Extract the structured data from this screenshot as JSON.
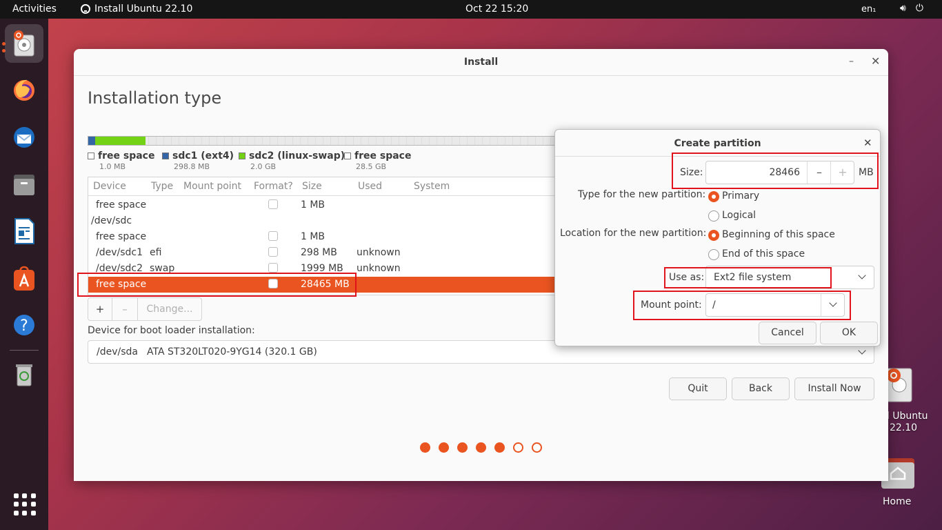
{
  "topbar": {
    "activities": "Activities",
    "app_name": "Install Ubuntu 22.10",
    "clock": "Oct 22  15:20",
    "lang": "en₁"
  },
  "desktop": {
    "icon1_label_line1": "ll Ubuntu",
    "icon1_label_line2": "22.10",
    "home_label": "Home"
  },
  "window": {
    "title": "Install",
    "page_title": "Installation type"
  },
  "legend": [
    {
      "name": "free space",
      "size": "1.0 MB",
      "color": "#ffffff"
    },
    {
      "name": "sdc1 (ext4)",
      "size": "298.8 MB",
      "color": "#3465a4"
    },
    {
      "name": "sdc2 (linux-swap)",
      "size": "2.0 GB",
      "color": "#73d216"
    },
    {
      "name": "free space",
      "size": "28.5 GB",
      "color": "#ffffff"
    }
  ],
  "table": {
    "headers": {
      "device": "Device",
      "type": "Type",
      "mount": "Mount point",
      "format": "Format?",
      "size": "Size",
      "used": "Used",
      "system": "System"
    },
    "rows": [
      {
        "device": "free space",
        "type": "",
        "size": "1 MB",
        "used": ""
      },
      {
        "device": "/dev/sdc",
        "type": "",
        "size": "",
        "used": ""
      },
      {
        "device": "free space",
        "type": "",
        "size": "1 MB",
        "used": ""
      },
      {
        "device": "/dev/sdc1",
        "type": "efi",
        "size": "298 MB",
        "used": "unknown"
      },
      {
        "device": "/dev/sdc2",
        "type": "swap",
        "size": "1999 MB",
        "used": "unknown"
      },
      {
        "device": "free space",
        "type": "",
        "size": "28465 MB",
        "used": ""
      }
    ]
  },
  "toolbar": {
    "add": "+",
    "remove": "–",
    "change": "Change..."
  },
  "boot": {
    "label": "Device for boot loader installation:",
    "device": "/dev/sda",
    "model": "ATA ST320LT020-9YG14 (320.1 GB)"
  },
  "buttons": {
    "quit": "Quit",
    "back": "Back",
    "install": "Install Now"
  },
  "progress": {
    "total": 7,
    "done": 5
  },
  "dialog": {
    "title": "Create partition",
    "size_label": "Size:",
    "size_value": "28466",
    "size_unit": "MB",
    "type_label": "Type for the new partition:",
    "type_primary": "Primary",
    "type_logical": "Logical",
    "location_label": "Location for the new partition:",
    "loc_begin": "Beginning of this space",
    "loc_end": "End of this space",
    "useas_label": "Use as:",
    "useas_value": "Ext2 file system",
    "mount_label": "Mount point:",
    "mount_value": "/",
    "cancel": "Cancel",
    "ok": "OK"
  },
  "colors": {
    "accent": "#e95420",
    "highlight": "#e0121a"
  }
}
